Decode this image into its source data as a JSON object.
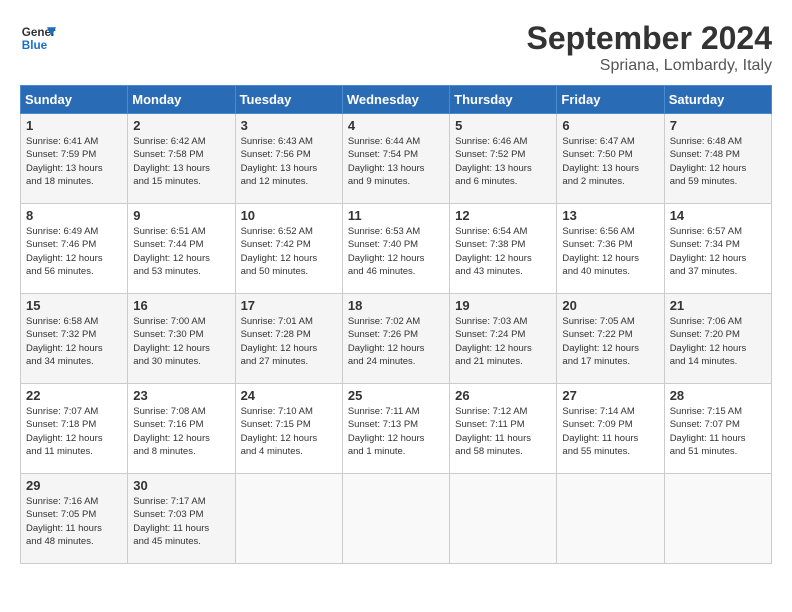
{
  "header": {
    "logo_general": "General",
    "logo_blue": "Blue",
    "month_title": "September 2024",
    "location": "Spriana, Lombardy, Italy"
  },
  "days_of_week": [
    "Sunday",
    "Monday",
    "Tuesday",
    "Wednesday",
    "Thursday",
    "Friday",
    "Saturday"
  ],
  "weeks": [
    [
      {
        "num": "1",
        "sunrise": "6:41 AM",
        "sunset": "7:59 PM",
        "daylight": "13 hours and 18 minutes."
      },
      {
        "num": "2",
        "sunrise": "6:42 AM",
        "sunset": "7:58 PM",
        "daylight": "13 hours and 15 minutes."
      },
      {
        "num": "3",
        "sunrise": "6:43 AM",
        "sunset": "7:56 PM",
        "daylight": "13 hours and 12 minutes."
      },
      {
        "num": "4",
        "sunrise": "6:44 AM",
        "sunset": "7:54 PM",
        "daylight": "13 hours and 9 minutes."
      },
      {
        "num": "5",
        "sunrise": "6:46 AM",
        "sunset": "7:52 PM",
        "daylight": "13 hours and 6 minutes."
      },
      {
        "num": "6",
        "sunrise": "6:47 AM",
        "sunset": "7:50 PM",
        "daylight": "13 hours and 2 minutes."
      },
      {
        "num": "7",
        "sunrise": "6:48 AM",
        "sunset": "7:48 PM",
        "daylight": "12 hours and 59 minutes."
      }
    ],
    [
      {
        "num": "8",
        "sunrise": "6:49 AM",
        "sunset": "7:46 PM",
        "daylight": "12 hours and 56 minutes."
      },
      {
        "num": "9",
        "sunrise": "6:51 AM",
        "sunset": "7:44 PM",
        "daylight": "12 hours and 53 minutes."
      },
      {
        "num": "10",
        "sunrise": "6:52 AM",
        "sunset": "7:42 PM",
        "daylight": "12 hours and 50 minutes."
      },
      {
        "num": "11",
        "sunrise": "6:53 AM",
        "sunset": "7:40 PM",
        "daylight": "12 hours and 46 minutes."
      },
      {
        "num": "12",
        "sunrise": "6:54 AM",
        "sunset": "7:38 PM",
        "daylight": "12 hours and 43 minutes."
      },
      {
        "num": "13",
        "sunrise": "6:56 AM",
        "sunset": "7:36 PM",
        "daylight": "12 hours and 40 minutes."
      },
      {
        "num": "14",
        "sunrise": "6:57 AM",
        "sunset": "7:34 PM",
        "daylight": "12 hours and 37 minutes."
      }
    ],
    [
      {
        "num": "15",
        "sunrise": "6:58 AM",
        "sunset": "7:32 PM",
        "daylight": "12 hours and 34 minutes."
      },
      {
        "num": "16",
        "sunrise": "7:00 AM",
        "sunset": "7:30 PM",
        "daylight": "12 hours and 30 minutes."
      },
      {
        "num": "17",
        "sunrise": "7:01 AM",
        "sunset": "7:28 PM",
        "daylight": "12 hours and 27 minutes."
      },
      {
        "num": "18",
        "sunrise": "7:02 AM",
        "sunset": "7:26 PM",
        "daylight": "12 hours and 24 minutes."
      },
      {
        "num": "19",
        "sunrise": "7:03 AM",
        "sunset": "7:24 PM",
        "daylight": "12 hours and 21 minutes."
      },
      {
        "num": "20",
        "sunrise": "7:05 AM",
        "sunset": "7:22 PM",
        "daylight": "12 hours and 17 minutes."
      },
      {
        "num": "21",
        "sunrise": "7:06 AM",
        "sunset": "7:20 PM",
        "daylight": "12 hours and 14 minutes."
      }
    ],
    [
      {
        "num": "22",
        "sunrise": "7:07 AM",
        "sunset": "7:18 PM",
        "daylight": "12 hours and 11 minutes."
      },
      {
        "num": "23",
        "sunrise": "7:08 AM",
        "sunset": "7:16 PM",
        "daylight": "12 hours and 8 minutes."
      },
      {
        "num": "24",
        "sunrise": "7:10 AM",
        "sunset": "7:15 PM",
        "daylight": "12 hours and 4 minutes."
      },
      {
        "num": "25",
        "sunrise": "7:11 AM",
        "sunset": "7:13 PM",
        "daylight": "12 hours and 1 minute."
      },
      {
        "num": "26",
        "sunrise": "7:12 AM",
        "sunset": "7:11 PM",
        "daylight": "11 hours and 58 minutes."
      },
      {
        "num": "27",
        "sunrise": "7:14 AM",
        "sunset": "7:09 PM",
        "daylight": "11 hours and 55 minutes."
      },
      {
        "num": "28",
        "sunrise": "7:15 AM",
        "sunset": "7:07 PM",
        "daylight": "11 hours and 51 minutes."
      }
    ],
    [
      {
        "num": "29",
        "sunrise": "7:16 AM",
        "sunset": "7:05 PM",
        "daylight": "11 hours and 48 minutes."
      },
      {
        "num": "30",
        "sunrise": "7:17 AM",
        "sunset": "7:03 PM",
        "daylight": "11 hours and 45 minutes."
      },
      null,
      null,
      null,
      null,
      null
    ]
  ],
  "labels": {
    "sunrise": "Sunrise:",
    "sunset": "Sunset:",
    "daylight": "Daylight hours"
  }
}
